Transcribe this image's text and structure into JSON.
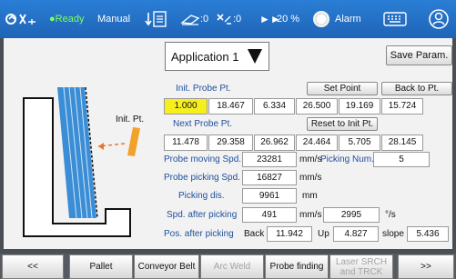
{
  "status_bar": {
    "status_text": "Ready",
    "mode": "Manual",
    "counter_1": ":0",
    "counter_2": ":0",
    "speed_percent": "20 %",
    "alarm_label": "Alarm",
    "status_color": "#7cff5a"
  },
  "main": {
    "application_select": "Application 1",
    "save_param_label": "Save Param.",
    "init_probe_label": "Init. Probe Pt.",
    "set_point_label": "Set Point",
    "back_to_pt_label": "Back to Pt.",
    "init_values": [
      "1.000",
      "18.467",
      "6.334",
      "26.500",
      "19.169",
      "15.724"
    ],
    "next_probe_label": "Next Probe Pt.",
    "reset_init_label": "Reset to Init Pt.",
    "next_values": [
      "11.478",
      "29.358",
      "26.962",
      "24.464",
      "5.705",
      "28.145"
    ],
    "diagram_init_label": "Init. Pt.",
    "probe_moving_speed_label": "Probe moving Spd.",
    "probe_moving_speed_value": "23281",
    "probe_moving_speed_unit": "mm/s",
    "picking_num_label": "Picking Num.",
    "picking_num_value": "5",
    "probe_picking_speed_label": "Probe picking Spd.",
    "probe_picking_speed_value": "16827",
    "probe_picking_speed_unit": "mm/s",
    "picking_dis_label": "Picking dis.",
    "picking_dis_value": "9961",
    "picking_dis_unit": "mm",
    "spd_after_picking_label": "Spd. after picking",
    "spd_after_picking_value": "491",
    "spd_after_picking_unit": "mm/s",
    "spd_after_picking_value2": "2995",
    "spd_after_picking_unit2": "°/s",
    "pos_after_picking_label": "Pos. after picking",
    "back_label": "Back",
    "back_value": "11.942",
    "up_label": "Up",
    "up_value": "4.827",
    "slope_label": "slope",
    "slope_value": "5.436"
  },
  "bottom_nav": {
    "prev": "<<",
    "pallet": "Pallet",
    "conveyor_belt": "Conveyor Belt",
    "arc_weld": "Arc Weld",
    "probe_finding": "Probe finding",
    "laser_srch_line1": "Laser SRCH",
    "laser_srch_line2": "and TRCK",
    "next": ">>"
  }
}
